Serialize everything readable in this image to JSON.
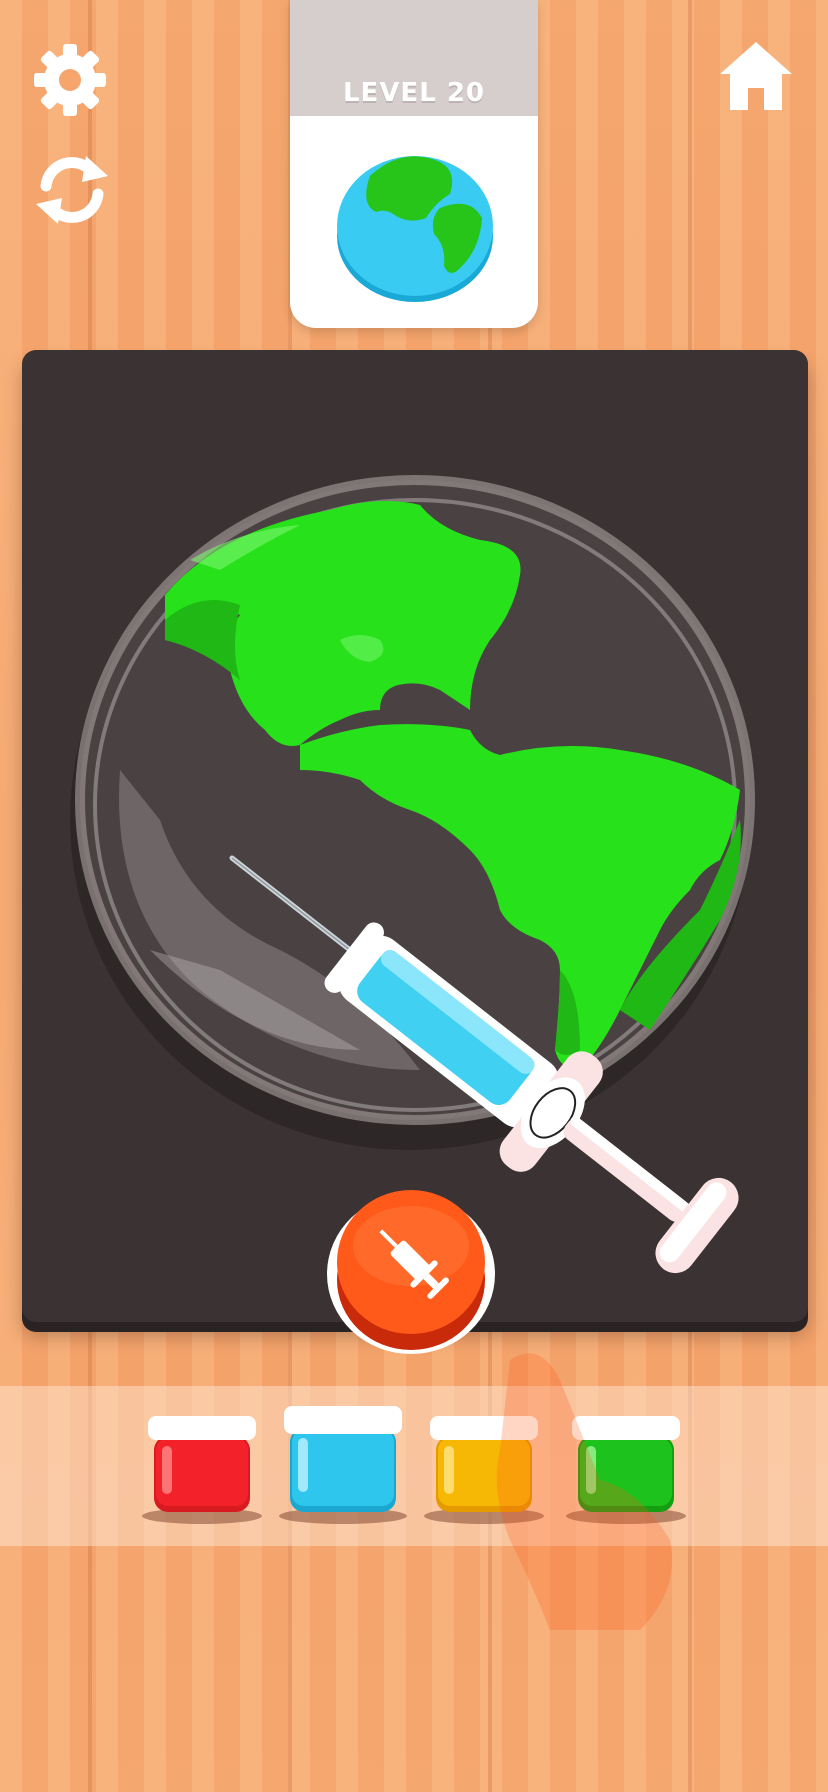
{
  "level": {
    "label": "LEVEL 20"
  },
  "hud": {
    "settings_icon": "gear-icon",
    "restart_icon": "refresh-icon",
    "home_icon": "home-icon"
  },
  "target_preview": {
    "icon": "earth-globe-icon"
  },
  "action_button": {
    "icon": "syringe-icon",
    "color": "#ff5a1a"
  },
  "paints": [
    {
      "name": "red",
      "color": "#f2212a"
    },
    {
      "name": "blue",
      "color": "#2ec6ec"
    },
    {
      "name": "yellow",
      "color": "#f7b705"
    },
    {
      "name": "green",
      "color": "#1ec21c"
    }
  ],
  "colors": {
    "board": "#3b3333",
    "wood": "#f6a56d",
    "slime_green": "#27e21b",
    "syringe_fill": "#3fd0f2"
  }
}
